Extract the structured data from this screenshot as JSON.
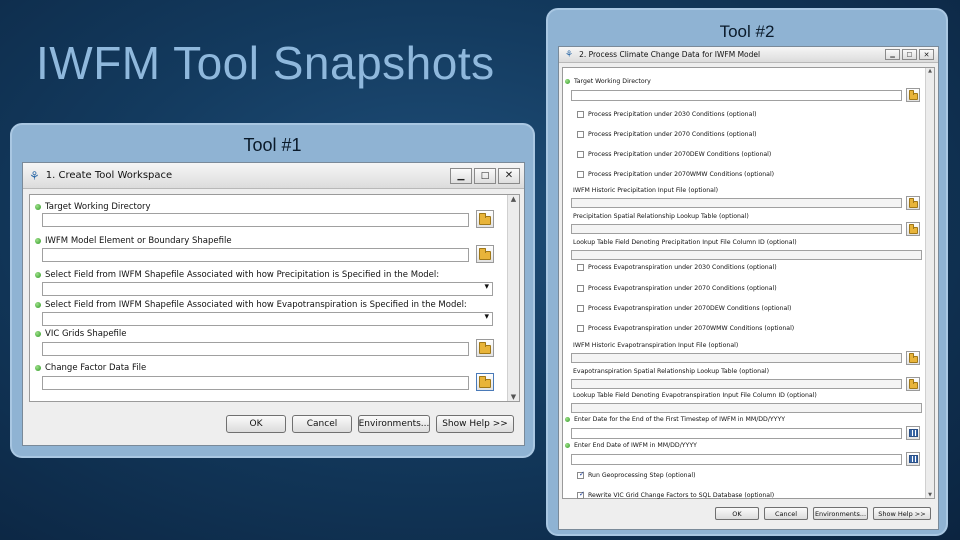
{
  "slide": {
    "title": "IWFM Tool Snapshots"
  },
  "tool1": {
    "label": "Tool #1",
    "dialog_title": "1. Create Tool Workspace",
    "fields": [
      {
        "label": "Target Working Directory",
        "type": "folder"
      },
      {
        "label": "IWFM Model Element or Boundary Shapefile",
        "type": "folder"
      },
      {
        "label": "Select Field from IWFM Shapefile Associated with how Precipitation is Specified in the Model:",
        "type": "dropdown"
      },
      {
        "label": "Select Field from IWFM Shapefile Associated with how Evapotranspiration is Specified in the Model:",
        "type": "dropdown"
      },
      {
        "label": "VIC Grids Shapefile",
        "type": "folder"
      },
      {
        "label": "Change Factor Data File",
        "type": "folder"
      }
    ],
    "buttons": {
      "ok": "OK",
      "cancel": "Cancel",
      "environments": "Environments...",
      "show_help": "Show Help >>"
    }
  },
  "tool2": {
    "label": "Tool #2",
    "dialog_title": "2. Process Climate Change Data for IWFM Model",
    "items": [
      {
        "label": "Target Working Directory",
        "type": "required-folder"
      },
      {
        "label": "Process Precipitation under 2030 Conditions (optional)",
        "type": "checkbox",
        "checked": false
      },
      {
        "label": "Process Precipitation under 2070 Conditions (optional)",
        "type": "checkbox",
        "checked": false
      },
      {
        "label": "Process Precipitation under 2070DEW Conditions (optional)",
        "type": "checkbox",
        "checked": false
      },
      {
        "label": "Process Precipitation under 2070WMW Conditions (optional)",
        "type": "checkbox",
        "checked": false
      },
      {
        "label": "IWFM Historic Precipitation Input File (optional)",
        "type": "folder"
      },
      {
        "label": "Precipitation Spatial Relationship Lookup Table (optional)",
        "type": "folder"
      },
      {
        "label": "Lookup Table Field Denoting Precipitation Input File Column ID (optional)",
        "type": "field"
      },
      {
        "label": "Process Evapotranspiration under 2030 Conditions (optional)",
        "type": "checkbox",
        "checked": false
      },
      {
        "label": "Process Evapotranspiration under 2070 Conditions (optional)",
        "type": "checkbox",
        "checked": false
      },
      {
        "label": "Process Evapotranspiration under 2070DEW Conditions (optional)",
        "type": "checkbox",
        "checked": false
      },
      {
        "label": "Process Evapotranspiration under 2070WMW Conditions (optional)",
        "type": "checkbox",
        "checked": false
      },
      {
        "label": "IWFM Historic Evapotranspiration Input File (optional)",
        "type": "folder"
      },
      {
        "label": "Evapotranspiration Spatial Relationship Lookup Table (optional)",
        "type": "folder"
      },
      {
        "label": "Lookup Table Field Denoting Evapotranspiration Input File Column ID (optional)",
        "type": "field"
      },
      {
        "label": "Enter Date for the End of the First Timestep of IWFM in MM/DD/YYYY",
        "type": "required-date"
      },
      {
        "label": "Enter End Date of IWFM in MM/DD/YYYY",
        "type": "required-date"
      },
      {
        "label": "Run Geoprocessing Step (optional)",
        "type": "checkbox",
        "checked": true
      },
      {
        "label": "Rewrite VIC Grid Change Factors to SQL Database (optional)",
        "type": "checkbox",
        "checked": true
      }
    ],
    "buttons": {
      "ok": "OK",
      "cancel": "Cancel",
      "environments": "Environments...",
      "show_help": "Show Help >>"
    }
  },
  "colors": {
    "background": "#133a5e",
    "panel": "#8fb3d3",
    "title": "#8fb8dc"
  },
  "icons": {
    "folder": "folder-open-icon",
    "calendar": "calendar-icon",
    "app": "toolbox-icon",
    "required": "green-dot-icon"
  }
}
